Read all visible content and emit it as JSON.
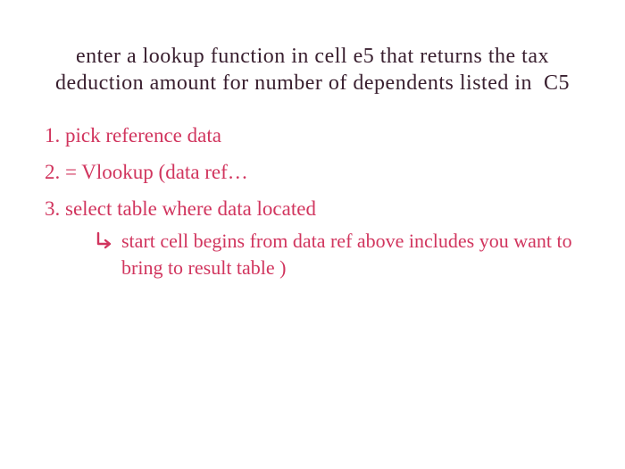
{
  "colors": {
    "ink": "#3a2030",
    "accent": "#d1355e"
  },
  "title": "enter a lookup function in cell e5 that returns the tax deduction amount for number of dependents listed in  C5",
  "steps": [
    {
      "num": "1.",
      "text": "pick reference data"
    },
    {
      "num": "2.",
      "text": "= Vlookup (data ref…"
    },
    {
      "num": "3.",
      "text": "select table where data located"
    }
  ],
  "substep": {
    "arrow_name": "sub-arrow-icon",
    "text": "start cell begins from data ref above includes you want to bring to result table )"
  }
}
